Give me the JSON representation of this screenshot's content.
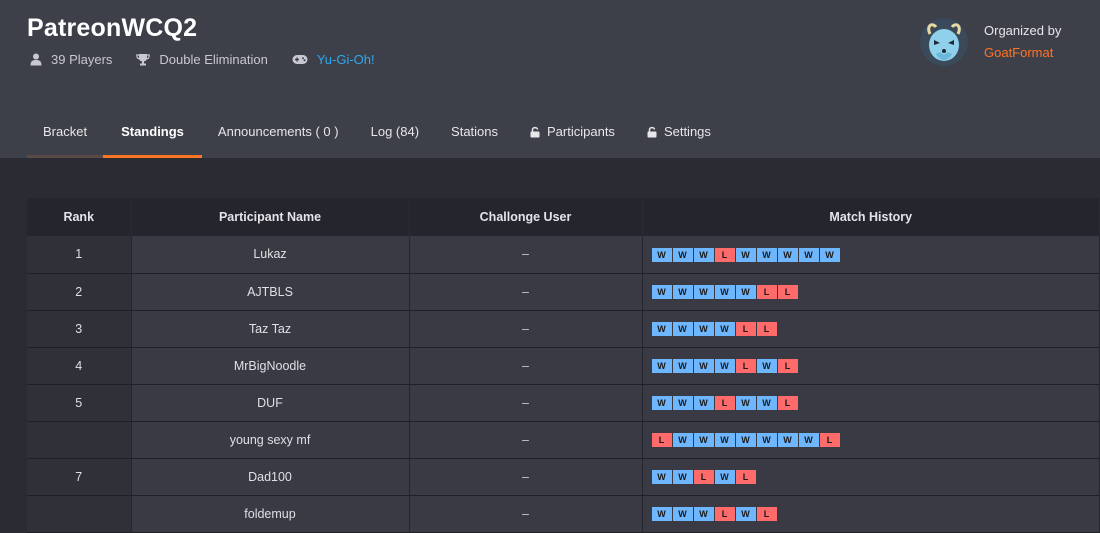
{
  "tournament": {
    "title": "PatreonWCQ2",
    "players": "39 Players",
    "format": "Double Elimination",
    "game": "Yu-Gi-Oh!"
  },
  "organizer": {
    "label": "Organized by",
    "name": "GoatFormat"
  },
  "tabs": [
    {
      "label": "Bracket",
      "locked": false,
      "active": false
    },
    {
      "label": "Standings",
      "locked": false,
      "active": true
    },
    {
      "label": "Announcements ( 0 )",
      "locked": false,
      "active": false
    },
    {
      "label": "Log (84)",
      "locked": false,
      "active": false
    },
    {
      "label": "Stations",
      "locked": false,
      "active": false
    },
    {
      "label": "Participants",
      "locked": true,
      "active": false
    },
    {
      "label": "Settings",
      "locked": true,
      "active": false
    }
  ],
  "table": {
    "headers": {
      "rank": "Rank",
      "name": "Participant Name",
      "challonge": "Challonge User",
      "history": "Match History"
    },
    "rows": [
      {
        "rank": "1",
        "name": "Lukaz",
        "challonge": "–",
        "history": [
          "W",
          "W",
          "W",
          "L",
          "W",
          "W",
          "W",
          "W",
          "W"
        ]
      },
      {
        "rank": "2",
        "name": "AJTBLS",
        "challonge": "–",
        "history": [
          "W",
          "W",
          "W",
          "W",
          "W",
          "L",
          "L"
        ]
      },
      {
        "rank": "3",
        "name": "Taz Taz",
        "challonge": "–",
        "history": [
          "W",
          "W",
          "W",
          "W",
          "L",
          "L"
        ]
      },
      {
        "rank": "4",
        "name": "MrBigNoodle",
        "challonge": "–",
        "history": [
          "W",
          "W",
          "W",
          "W",
          "L",
          "W",
          "L"
        ]
      },
      {
        "rank": "5",
        "name": "DUF",
        "challonge": "–",
        "history": [
          "W",
          "W",
          "W",
          "L",
          "W",
          "W",
          "L"
        ]
      },
      {
        "rank": "",
        "name": "young sexy mf",
        "challonge": "–",
        "history": [
          "L",
          "W",
          "W",
          "W",
          "W",
          "W",
          "W",
          "W",
          "L"
        ]
      },
      {
        "rank": "7",
        "name": "Dad100",
        "challonge": "–",
        "history": [
          "W",
          "W",
          "L",
          "W",
          "L"
        ]
      },
      {
        "rank": "",
        "name": "foldemup",
        "challonge": "–",
        "history": [
          "W",
          "W",
          "W",
          "L",
          "W",
          "L"
        ]
      }
    ]
  },
  "colors": {
    "accent": "#ff7324",
    "win": "#6eb7ff",
    "loss": "#ff6b6b",
    "link": "#2ea8f0"
  }
}
